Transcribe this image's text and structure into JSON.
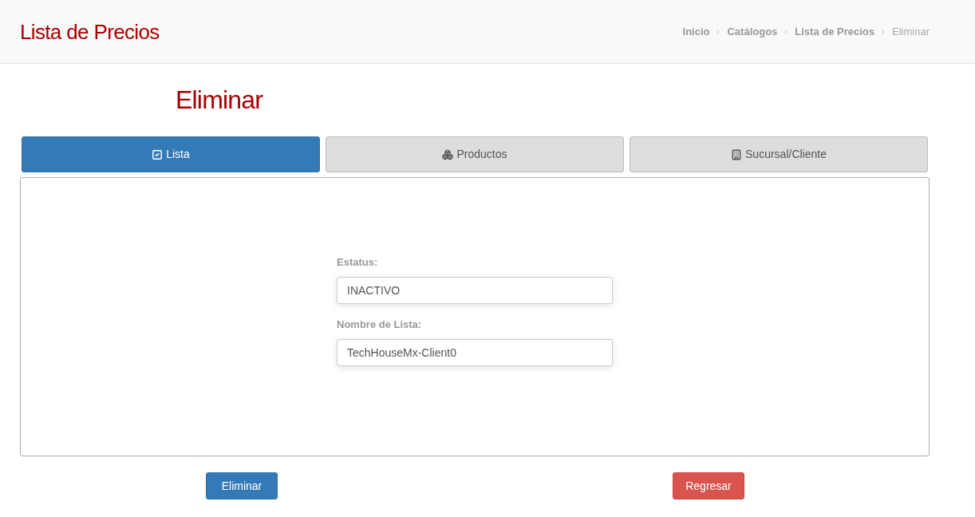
{
  "header": {
    "title": "Lista de Precios",
    "breadcrumb": [
      {
        "label": "Inicio",
        "current": false
      },
      {
        "label": "Catálogos",
        "current": false
      },
      {
        "label": "Lista de Precios",
        "current": false
      },
      {
        "label": "Eliminar",
        "current": true
      }
    ]
  },
  "page_title": "Eliminar",
  "tabs": [
    {
      "label": "Lista",
      "selected": true
    },
    {
      "label": "Productos",
      "selected": false
    },
    {
      "label": "Sucursal/Cliente",
      "selected": false
    }
  ],
  "form": {
    "fields": [
      {
        "label": "Estatus:",
        "value": "INACTIVO"
      },
      {
        "label": "Nombre de Lista:",
        "value": "TechHouseMx-Client0"
      }
    ]
  },
  "buttons": [
    {
      "label": "Eliminar",
      "kind": "primary"
    },
    {
      "label": "Regresar",
      "kind": "danger"
    }
  ]
}
